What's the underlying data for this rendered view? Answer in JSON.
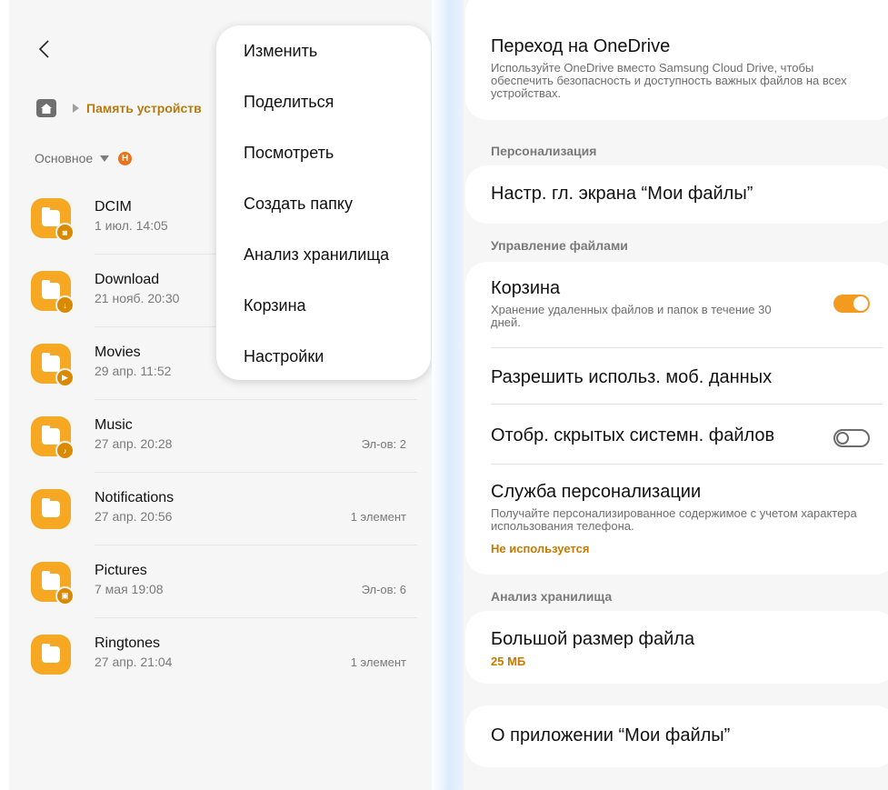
{
  "files_screen": {
    "breadcrumb": {
      "home_icon": "home-icon",
      "path_label": "Память устройств"
    },
    "sort": {
      "label": "Основное",
      "badge": "Н"
    },
    "files": [
      {
        "name": "DCIM",
        "date": "1 июл. 14:05",
        "count": "",
        "badge_icon": "camera-icon"
      },
      {
        "name": "Download",
        "date": "21 нояб. 20:30",
        "count": "",
        "badge_icon": "download-icon"
      },
      {
        "name": "Movies",
        "date": "29 апр. 11:52",
        "count": "",
        "badge_icon": "play-icon"
      },
      {
        "name": "Music",
        "date": "27 апр. 20:28",
        "count": "Эл-ов: 2",
        "badge_icon": "music-note-icon"
      },
      {
        "name": "Notifications",
        "date": "27 апр. 20:56",
        "count": "1 элемент",
        "badge_icon": ""
      },
      {
        "name": "Pictures",
        "date": "7 мая 19:08",
        "count": "Эл-ов: 6",
        "badge_icon": "image-icon"
      },
      {
        "name": "Ringtones",
        "date": "27 апр. 21:04",
        "count": "1 элемент",
        "badge_icon": ""
      }
    ],
    "menu": [
      "Изменить",
      "Поделиться",
      "Посмотреть",
      "Создать папку",
      "Анализ хранилища",
      "Корзина",
      "Настройки"
    ]
  },
  "settings_screen": {
    "onedrive": {
      "title": "Переход на OneDrive",
      "desc": "Используйте OneDrive вместо Samsung Cloud Drive, чтобы обеспечить безопасность и доступность важных файлов на всех устройствах."
    },
    "personalization_header": "Персонализация",
    "home_settings": "Настр. гл. экрана “Мои файлы”",
    "file_management_header": "Управление файлами",
    "trash": {
      "title": "Корзина",
      "desc": "Хранение удаленных файлов и папок в течение 30 дней.",
      "enabled": true
    },
    "mobile_data": "Разрешить использ. моб. данных",
    "hidden_files": {
      "title": "Отобр. скрытых системн. файлов",
      "enabled": false
    },
    "personalization_service": {
      "title": "Служба персонализации",
      "desc": "Получайте персонализированное содержимое с учетом характера использования телефона.",
      "status": "Не используется"
    },
    "storage_header": "Анализ хранилища",
    "large_file": {
      "title": "Большой размер файла",
      "value": "25 МБ"
    },
    "about": "О приложении “Мои файлы”"
  },
  "colors": {
    "accent": "#f7a823",
    "accent_text": "#c57a00",
    "toggle_on": "#f29b20"
  }
}
